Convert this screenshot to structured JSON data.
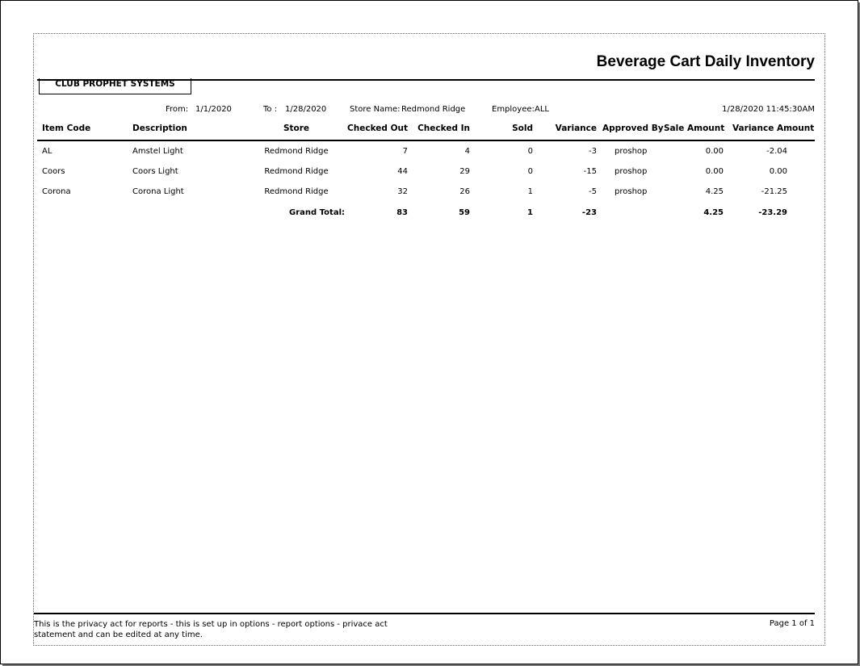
{
  "report": {
    "title": "Beverage Cart Daily Inventory",
    "company": "CLUB PROPHET SYSTEMS",
    "from_label": "From:",
    "from_value": "1/1/2020",
    "to_label": "To :",
    "to_value": "1/28/2020",
    "store_label": "Store Name:",
    "store_value": "Redmond Ridge",
    "employee_label": "Employee:",
    "employee_value": "ALL",
    "timestamp": "1/28/2020 11:45:30AM"
  },
  "table": {
    "headers": [
      "Item Code",
      "Description",
      "Store",
      "Checked Out",
      "Checked In",
      "Sold",
      "Variance",
      "Approved By",
      "Sale Amount",
      "Variance Amount"
    ],
    "rows": [
      [
        "AL",
        "Amstel Light",
        "Redmond Ridge",
        "7",
        "4",
        "0",
        "-3",
        "proshop",
        "0.00",
        "-2.04"
      ],
      [
        "Coors",
        "Coors Light",
        "Redmond Ridge",
        "44",
        "29",
        "0",
        "-15",
        "proshop",
        "0.00",
        "0.00"
      ],
      [
        "Corona",
        "Corona Light",
        "Redmond Ridge",
        "32",
        "26",
        "1",
        "-5",
        "proshop",
        "4.25",
        "-21.25"
      ]
    ],
    "total": {
      "label": "Grand Total:",
      "checked_out": "83",
      "checked_in": "59",
      "sold": "1",
      "variance": "-23",
      "sale_amount": "4.25",
      "variance_amount": "-23.29"
    }
  },
  "footer": {
    "privacy": "This is the privacy act for reports - this is set up in options - report options - privace act statement and can be edited at any time.",
    "page": "Page 1 of 1"
  }
}
